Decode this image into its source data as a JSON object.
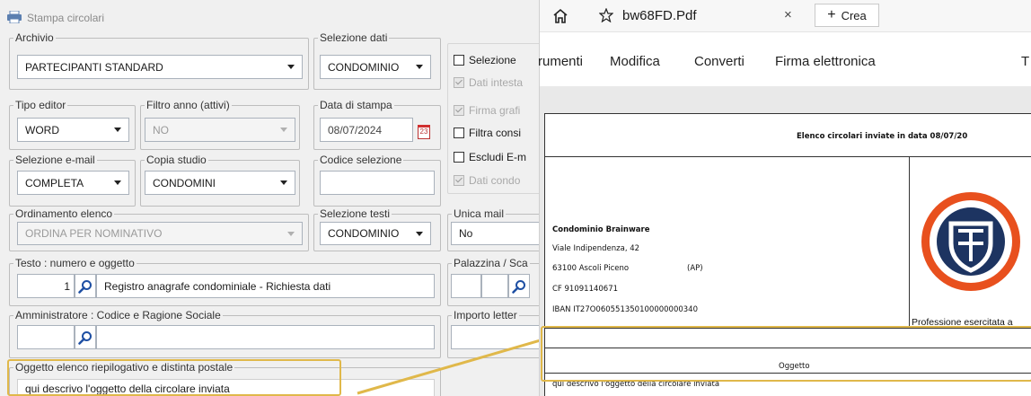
{
  "dialog": {
    "title": "Stampa circolari",
    "archivio": {
      "label": "Archivio",
      "value": "PARTECIPANTI STANDARD"
    },
    "selezione_dati": {
      "label": "Selezione dati",
      "value": "CONDOMINIO"
    },
    "tipo_editor": {
      "label": "Tipo editor",
      "value": "WORD"
    },
    "filtro_anno": {
      "label": "Filtro anno (attivi)",
      "value": "NO"
    },
    "data_stampa": {
      "label": "Data di stampa",
      "value": "08/07/2024",
      "calendar_day": "23"
    },
    "selezione_email": {
      "label": "Selezione e-mail",
      "value": "COMPLETA"
    },
    "copia_studio": {
      "label": "Copia studio",
      "value": "CONDOMINI"
    },
    "codice_selezione": {
      "label": "Codice selezione",
      "value": ""
    },
    "ordinamento": {
      "label": "Ordinamento elenco",
      "value": "ORDINA PER NOMINATIVO"
    },
    "selezione_testi": {
      "label": "Selezione testi",
      "value": "CONDOMINIO"
    },
    "unica_mail": {
      "label": "Unica mail",
      "value": "No"
    },
    "testo": {
      "label": "Testo : numero e oggetto",
      "numero": "1",
      "oggetto": "Registro anagrafe condominiale - Richiesta dati"
    },
    "palazzina": {
      "label": "Palazzina / Sca"
    },
    "amministratore": {
      "label": "Amministratore : Codice e Ragione Sociale",
      "codice": "",
      "ragione": ""
    },
    "importo": {
      "label": "Importo letter"
    },
    "oggetto_elenco": {
      "label": "Oggetto elenco riepilogativo e distinta postale",
      "value": "qui descrivo l'oggetto della circolare inviata"
    },
    "checks": [
      {
        "label": "Selezione",
        "enabled": true,
        "checked": false
      },
      {
        "label": "Dati intesta",
        "enabled": false,
        "checked": true
      },
      {
        "label": "Firma grafi",
        "enabled": false,
        "checked": true
      },
      {
        "label": "Filtra consi",
        "enabled": true,
        "checked": false
      },
      {
        "label": "Escludi E-m",
        "enabled": true,
        "checked": false
      },
      {
        "label": "Dati condo",
        "enabled": false,
        "checked": true
      }
    ]
  },
  "viewer": {
    "tab_title": "bw68FD.Pdf",
    "new_tab_label": "Crea",
    "menu": [
      "rumenti",
      "Modifica",
      "Converti",
      "Firma elettronica",
      "T"
    ],
    "document": {
      "header": "Elenco circolari inviate in data 08/07/20",
      "sender_name": "Condominio Brainware",
      "address": "Viale Indipendenza, 42",
      "city": "63100 Ascoli Piceno",
      "province": "(AP)",
      "cf": "CF 91091140671",
      "iban": "IBAN IT27O060551350100000000340",
      "profession": "Professione esercitata a",
      "oggetto_header": "Oggetto",
      "oggetto_text": "qui descrivo l'oggetto della circolare inviata"
    }
  },
  "colors": {
    "highlight": "#e0b84a",
    "logo_orange": "#e8501e",
    "logo_navy": "#1d3461"
  }
}
